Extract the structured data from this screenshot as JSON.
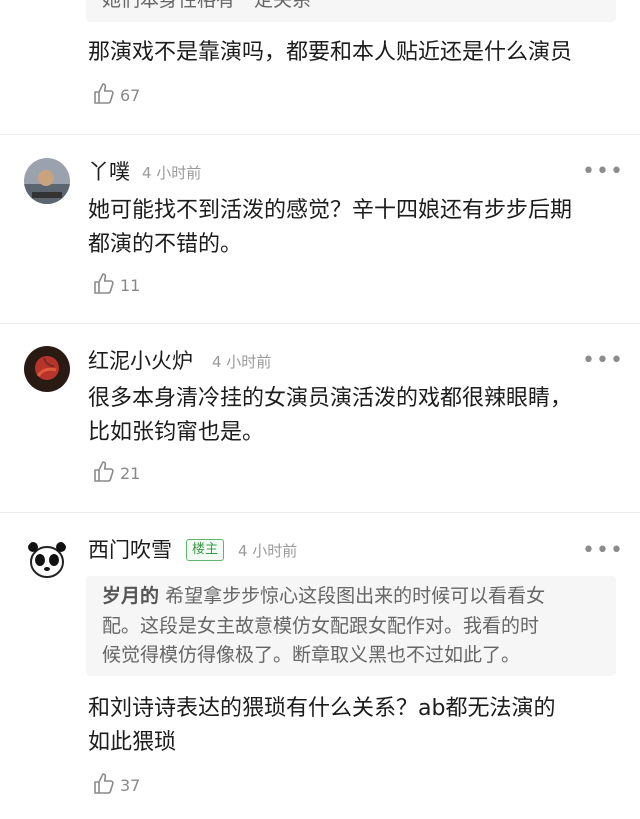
{
  "comments": [
    {
      "quote_partial": "她们本身性格有一定关系",
      "content": "那演戏不是靠演吗，都要和本人贴近还是什么演员",
      "likes": "67"
    },
    {
      "author": "丫噗",
      "time": "4 小时前",
      "content_line1": "她可能找不到活泼的感觉？辛十四娘还有步步后期",
      "content_line2": "都演的不错的。",
      "likes": "11"
    },
    {
      "author": "红泥小火炉",
      "time": "4 小时前",
      "content_line1": "很多本身清冷挂的女演员演活泼的戏都很辣眼睛，",
      "content_line2": "比如张钧甯也是。",
      "likes": "21"
    },
    {
      "author": "西门吹雪",
      "badge": "楼主",
      "time": "4 小时前",
      "quote_author": "岁月的",
      "quote_line1": "希望拿步步惊心这段图出来的时候可以看看女",
      "quote_line2": "配。这段是女主故意模仿女配跟女配作对。我看的时",
      "quote_line3": "候觉得模仿得像极了。断章取义黑也不过如此了。",
      "content_line1": "和刘诗诗表达的猥琐有什么关系？ab都无法演的",
      "content_line2": "如此猥琐",
      "likes": "37"
    }
  ],
  "more_label": "•••",
  "icons": {
    "like": "thumbs-up-icon",
    "more": "more-dots-icon"
  },
  "colors": {
    "badge_green": "#3c9b4b",
    "time_gray": "#9a9a9a",
    "divider": "#ececec"
  }
}
